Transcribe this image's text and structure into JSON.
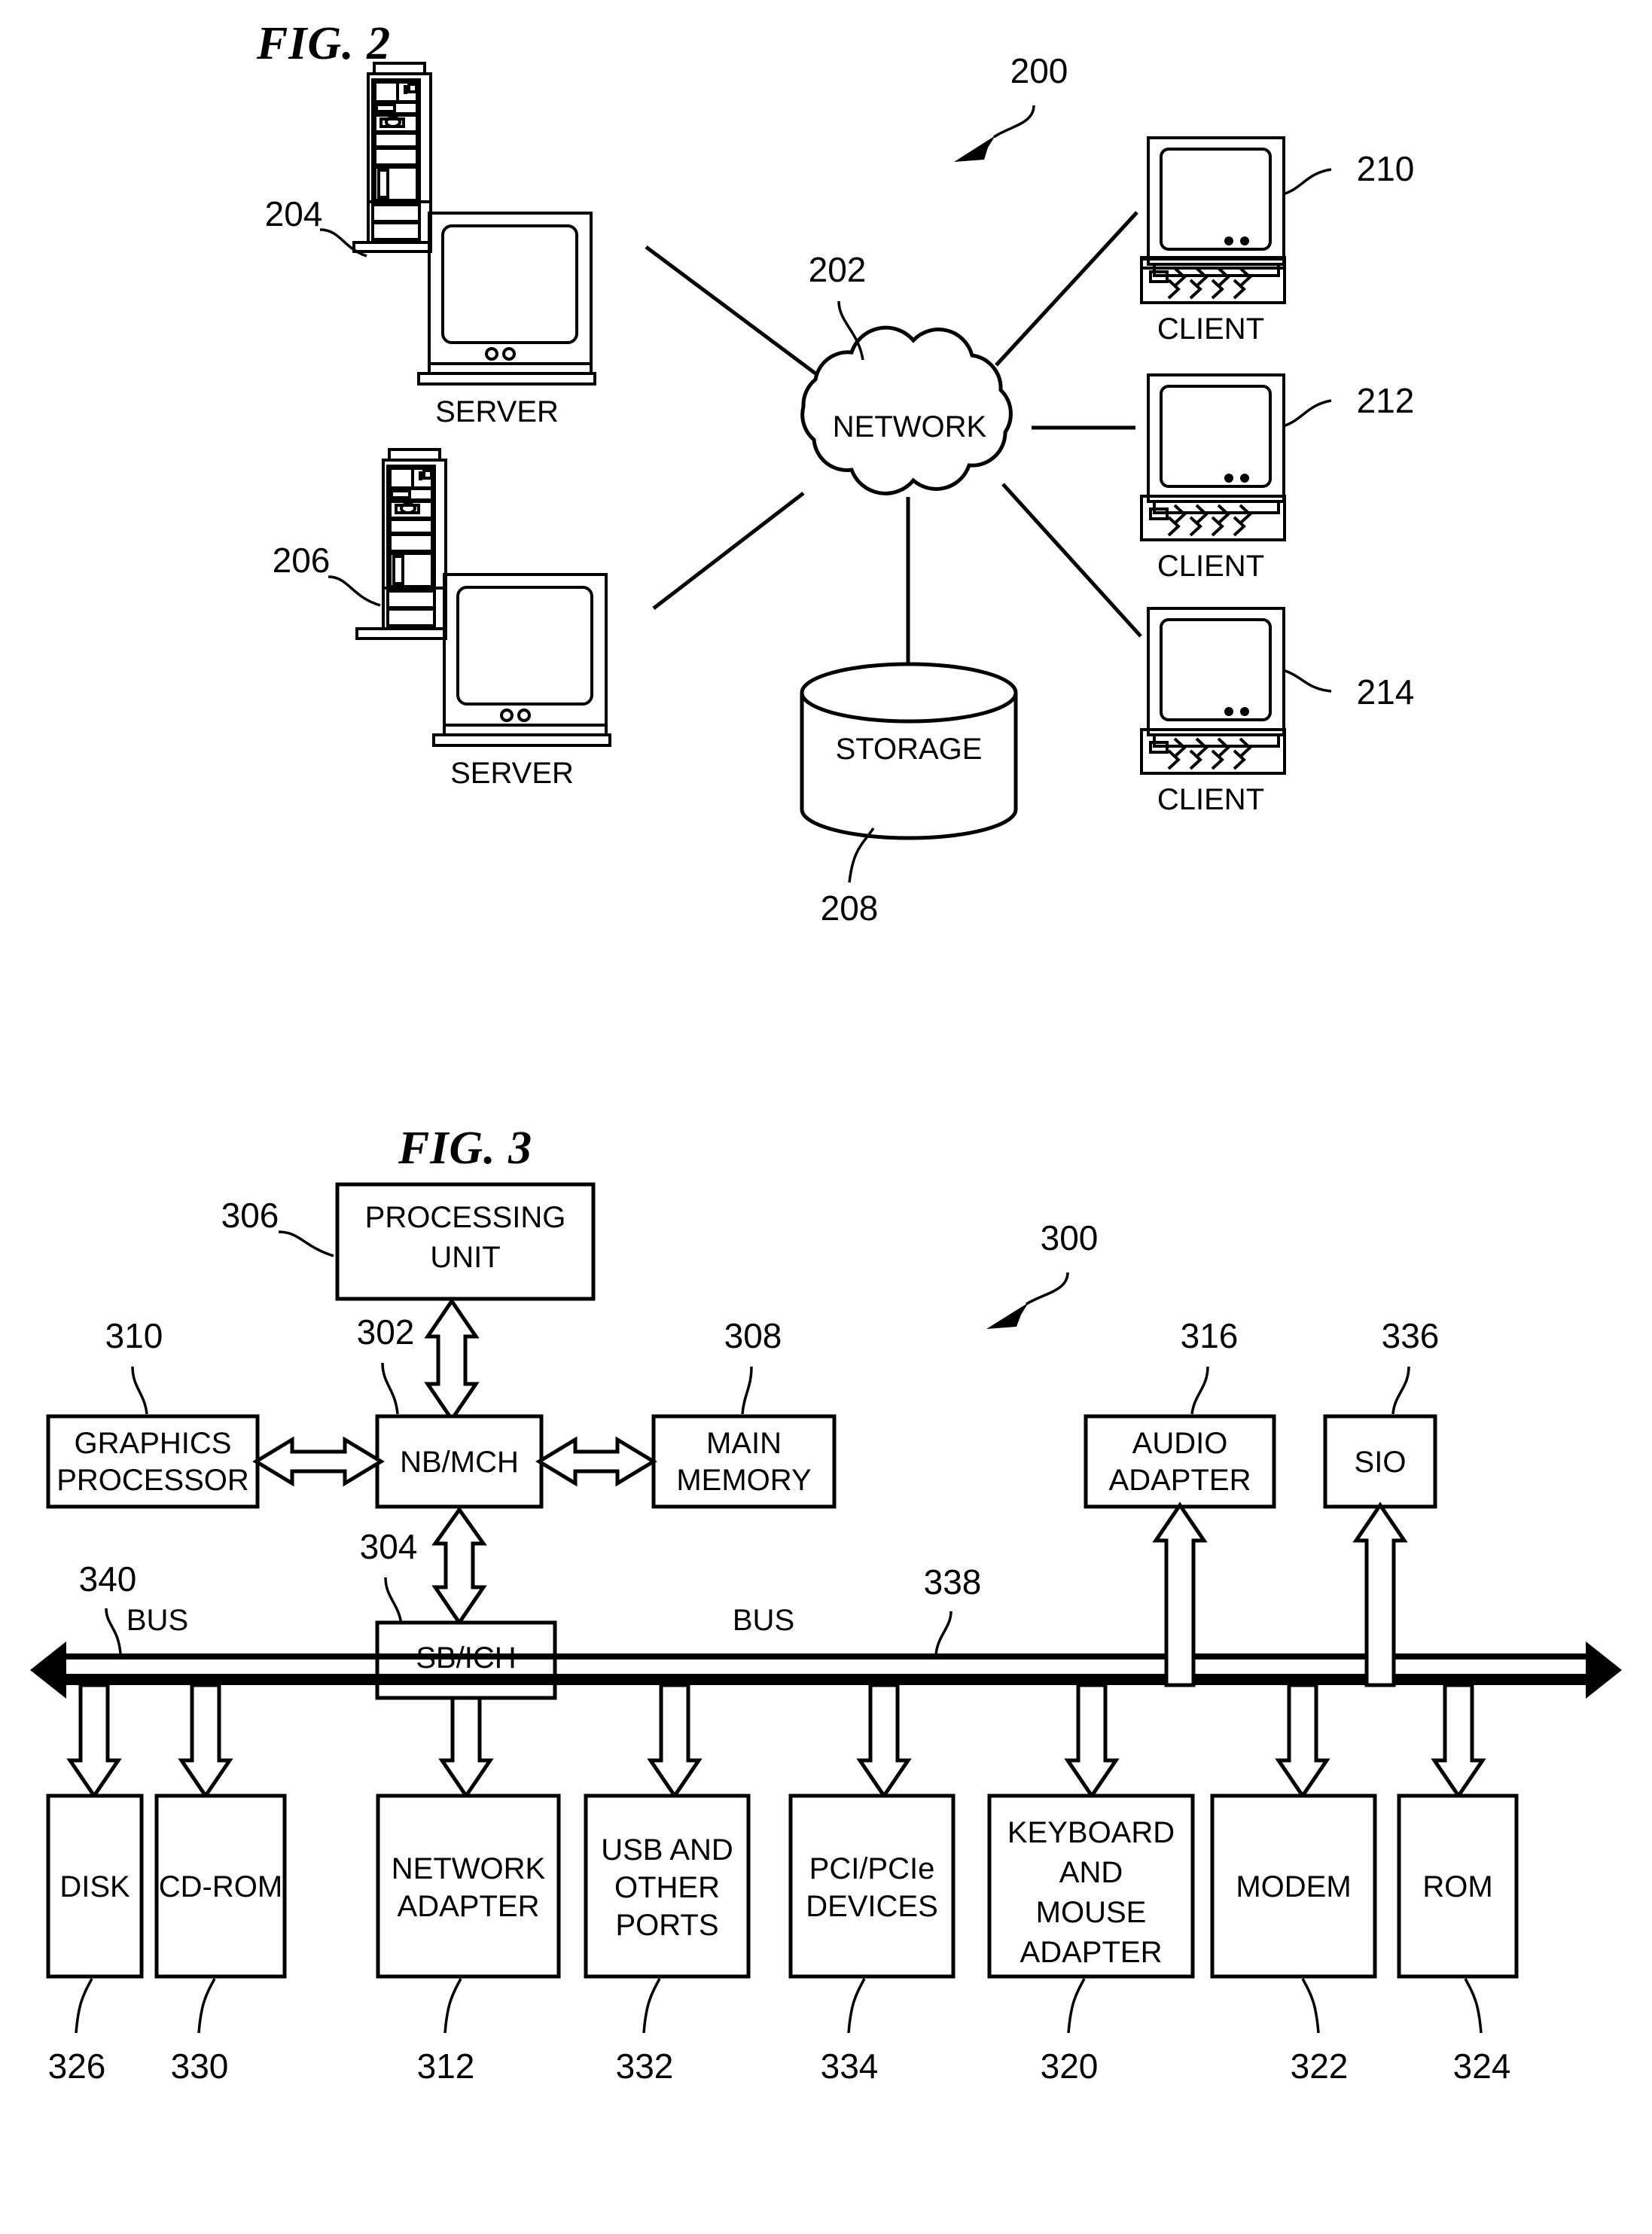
{
  "figures": [
    {
      "id": "fig2",
      "title": "FIG. 2",
      "system_ref": "200",
      "nodes": {
        "server_top": {
          "label": "SERVER",
          "ref": "204"
        },
        "server_bottom": {
          "label": "SERVER",
          "ref": "206"
        },
        "network": {
          "label": "NETWORK",
          "ref": "202"
        },
        "storage": {
          "label": "STORAGE",
          "ref": "208"
        },
        "client_1": {
          "label": "CLIENT",
          "ref": "210"
        },
        "client_2": {
          "label": "CLIENT",
          "ref": "212"
        },
        "client_3": {
          "label": "CLIENT",
          "ref": "214"
        }
      }
    },
    {
      "id": "fig3",
      "title": "FIG. 3",
      "system_ref": "300",
      "bus_left_label": "BUS",
      "bus_left_ref": "340",
      "bus_right_label": "BUS",
      "bus_right_ref": "338",
      "blocks": [
        {
          "key": "processing_unit",
          "label": "PROCESSING UNIT",
          "lines": [
            "PROCESSING",
            "UNIT"
          ],
          "ref": "306"
        },
        {
          "key": "nb_mch",
          "label": "NB/MCH",
          "lines": [
            "NB/MCH"
          ],
          "ref": "302"
        },
        {
          "key": "graphics_processor",
          "label": "GRAPHICS PROCESSOR",
          "lines": [
            "GRAPHICS",
            "PROCESSOR"
          ],
          "ref": "310"
        },
        {
          "key": "main_memory",
          "label": "MAIN MEMORY",
          "lines": [
            "MAIN",
            "MEMORY"
          ],
          "ref": "308"
        },
        {
          "key": "audio_adapter",
          "label": "AUDIO ADAPTER",
          "lines": [
            "AUDIO",
            "ADAPTER"
          ],
          "ref": "316"
        },
        {
          "key": "sio",
          "label": "SIO",
          "lines": [
            "SIO"
          ],
          "ref": "336"
        },
        {
          "key": "sb_ich",
          "label": "SB/ICH",
          "lines": [
            "SB/ICH"
          ],
          "ref": "304"
        },
        {
          "key": "disk",
          "label": "DISK",
          "lines": [
            "DISK"
          ],
          "ref": "326"
        },
        {
          "key": "cd_rom",
          "label": "CD-ROM",
          "lines": [
            "CD-ROM"
          ],
          "ref": "330"
        },
        {
          "key": "network_adapter",
          "label": "NETWORK ADAPTER",
          "lines": [
            "NETWORK",
            "ADAPTER"
          ],
          "ref": "312"
        },
        {
          "key": "usb_ports",
          "label": "USB AND OTHER PORTS",
          "lines": [
            "USB AND",
            "OTHER",
            "PORTS"
          ],
          "ref": "332"
        },
        {
          "key": "pci_devices",
          "label": "PCI/PCIe DEVICES",
          "lines": [
            "PCI/PCIe",
            "DEVICES"
          ],
          "ref": "334"
        },
        {
          "key": "keyboard_mouse",
          "label": "KEYBOARD AND MOUSE ADAPTER",
          "lines": [
            "KEYBOARD",
            "AND",
            "MOUSE",
            "ADAPTER"
          ],
          "ref": "320"
        },
        {
          "key": "modem",
          "label": "MODEM",
          "lines": [
            "MODEM"
          ],
          "ref": "322"
        },
        {
          "key": "rom",
          "label": "ROM",
          "lines": [
            "ROM"
          ],
          "ref": "324"
        }
      ]
    }
  ],
  "colors": {
    "ink": "#000000",
    "paper": "#ffffff"
  }
}
